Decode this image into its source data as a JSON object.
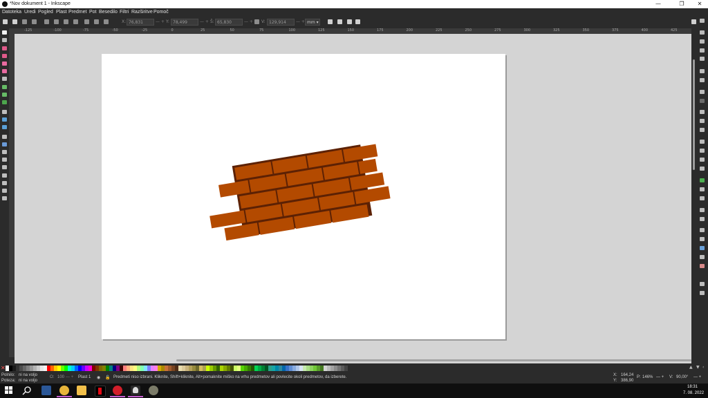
{
  "window": {
    "title": "*Nov dokument 1 - Inkscape",
    "controls": {
      "minimize": "—",
      "restore": "❐",
      "close": "✕"
    }
  },
  "menu": [
    "Datoteka",
    "Uredi",
    "Pogled",
    "Plast",
    "Predmet",
    "Pot",
    "Besedilo",
    "Filtri",
    "Razširitve",
    "Pomoč"
  ],
  "toolbar": {
    "x_label": "X:",
    "x_value": "76,831",
    "y_label": "Y:",
    "y_value": "78,499",
    "w_label": "Š:",
    "w_value": "65,830",
    "h_label": "V:",
    "h_value": "129,914",
    "unit": "mm"
  },
  "ruler_ticks": [
    "-125",
    "-100",
    "-75",
    "-50",
    "-25",
    "0",
    "25",
    "50",
    "75",
    "100",
    "125",
    "150",
    "175",
    "200",
    "225",
    "250",
    "275",
    "300",
    "325",
    "350",
    "375",
    "400",
    "425"
  ],
  "status": {
    "fill_label": "Polnilo:",
    "fill_value": "ni na voljo",
    "stroke_label": "Poteza:",
    "stroke_value": "ni na voljo",
    "opacity_label": "O:",
    "opacity_value": "100",
    "layer": "Plast 1",
    "message": "Predmeti niso izbrani. Kliknite, Shift+kliknite, Alt+pomaknite miško na vrhu predmetov ali povlecite okoli predmetov, da izberete.",
    "cursor_x_label": "X:",
    "cursor_x": "164,24",
    "cursor_y_label": "Y:",
    "cursor_y": "386,90",
    "zoom_label": "P:",
    "zoom": "146%",
    "rotation_label": "V:",
    "rotation": "90,00°"
  },
  "clock": {
    "time": "18:31",
    "date": "7. 08. 2022"
  },
  "colors": {
    "brick": "#b34a00",
    "mortar": "#5c2104",
    "page": "#ffffff",
    "canvas": "#d4d4d4"
  },
  "palette": [
    "#ffffff",
    "#000000",
    "#1a1a1a",
    "#333333",
    "#4d4d4d",
    "#666666",
    "#808080",
    "#999999",
    "#b3b3b3",
    "#cccccc",
    "#e6e6e6",
    "#f2f2f2",
    "#ff0000",
    "#ff6600",
    "#ffcc00",
    "#ffff00",
    "#66ff00",
    "#00ff00",
    "#00ffcc",
    "#00ccff",
    "#0066ff",
    "#0000ff",
    "#6600ff",
    "#cc00ff",
    "#ff00cc",
    "#800000",
    "#803300",
    "#806600",
    "#808000",
    "#008000",
    "#008080",
    "#000080",
    "#800080",
    "#400000",
    "#ff8080",
    "#ffb380",
    "#ffe680",
    "#ffff80",
    "#b3ff80",
    "#80ffb3",
    "#80e6ff",
    "#8080ff",
    "#e680ff",
    "#ff80e6",
    "#d4aa00",
    "#aa8800",
    "#c87137",
    "#a05a2c",
    "#784421",
    "#502d16",
    "#e9ddaf",
    "#dbc99a",
    "#c8b27c",
    "#b3a059",
    "#968a3c",
    "#6f6a2b",
    "#d3bc5f",
    "#aba050",
    "#ccff00",
    "#99cc00",
    "#669900",
    "#336600",
    "#aad400",
    "#88aa00",
    "#668000",
    "#445500",
    "#ccff66",
    "#e5ff80",
    "#55d400",
    "#44aa00",
    "#338000",
    "#225500",
    "#00d455",
    "#00aa44",
    "#008033",
    "#005522",
    "#2ca089",
    "#16a5a5",
    "#0088aa",
    "#2c89a0",
    "#0066aa",
    "#3771c8",
    "#5f8dd3",
    "#87aade",
    "#afc6e9",
    "#d7e3f4",
    "#c6e9af",
    "#aade87",
    "#8dd35f",
    "#71c837",
    "#5aa02c",
    "#447821",
    "#d3d3d3",
    "#bbbbbb",
    "#a3a3a3",
    "#8b8b8b",
    "#737373",
    "#5b5b5b",
    "#434343",
    "#2b2b2b"
  ],
  "taskbar_apps": [
    "start-icon",
    "search-icon",
    "word-icon",
    "chrome-icon",
    "explorer-icon",
    "netflix-icon",
    "opera-icon",
    "inkscape-icon",
    "gimp-icon"
  ]
}
